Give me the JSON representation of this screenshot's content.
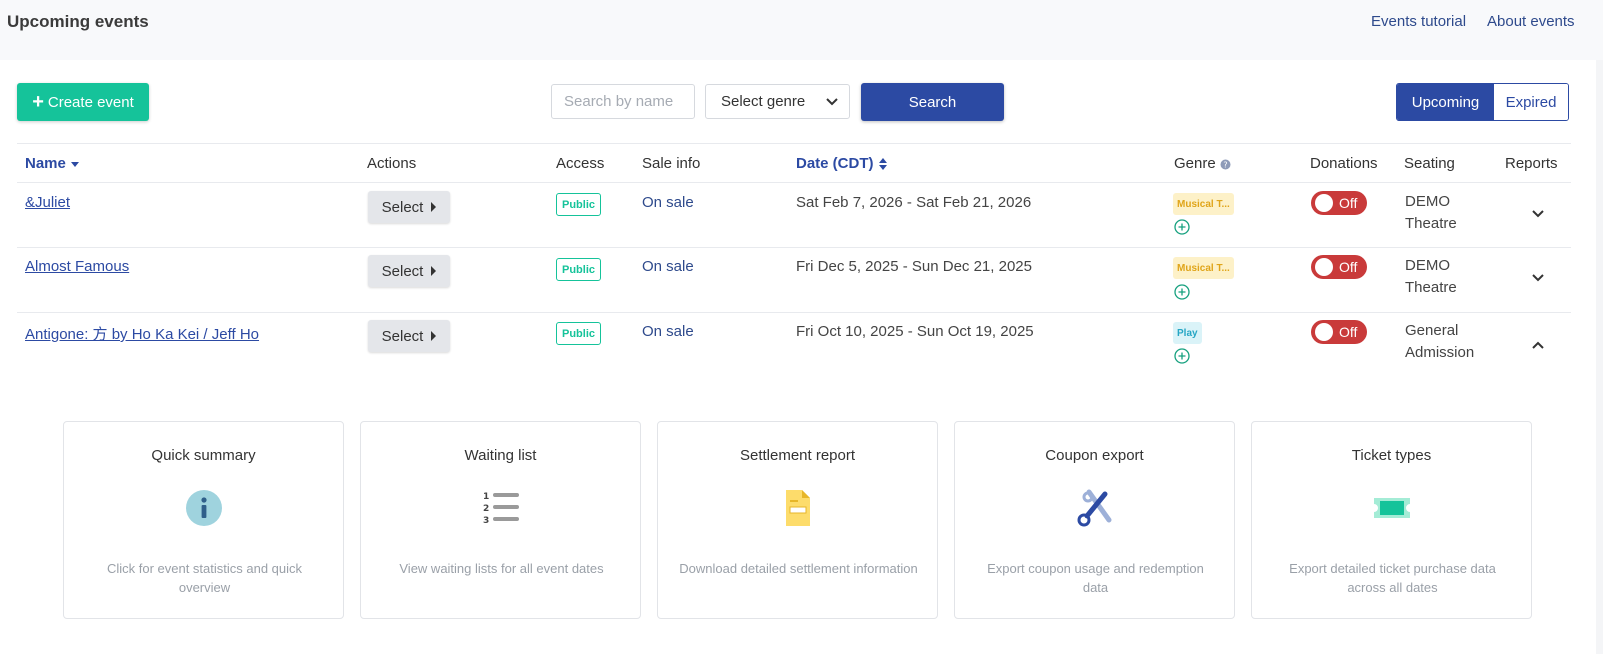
{
  "header": {
    "title": "Upcoming events",
    "links": [
      "Events tutorial",
      "About events"
    ]
  },
  "toolbar": {
    "create_label": "Create event",
    "search_placeholder": "Search by name",
    "genre_select": "Select genre",
    "search_label": "Search",
    "filter_upcoming": "Upcoming",
    "filter_expired": "Expired"
  },
  "table": {
    "columns": [
      "Name",
      "Actions",
      "Access",
      "Sale info",
      "Date (CDT)",
      "Genre",
      "Donations",
      "Seating",
      "Reports"
    ],
    "rows": [
      {
        "name": "&Juliet",
        "action": "Select",
        "access": "Public",
        "sale": "On sale",
        "date": "Sat Feb 7, 2026 - Sat Feb 21, 2026",
        "genre": "Musical T...",
        "donations": "Off",
        "seating": "DEMO Theatre"
      },
      {
        "name": "Almost Famous",
        "action": "Select",
        "access": "Public",
        "sale": "On sale",
        "date": "Fri Dec 5, 2025 - Sun Dec 21, 2025",
        "genre": "Musical T...",
        "donations": "Off",
        "seating": "DEMO Theatre"
      },
      {
        "name": "Antigone: 方 by Ho Ka Kei / Jeff Ho",
        "action": "Select",
        "access": "Public",
        "sale": "On sale",
        "date": "Fri Oct 10, 2025 - Sun Oct 19, 2025",
        "genre": "Play",
        "donations": "Off",
        "seating": "General Admission"
      }
    ]
  },
  "reports": [
    {
      "title": "Quick summary",
      "desc": "Click for event statistics and quick overview",
      "icon": "info-icon"
    },
    {
      "title": "Waiting list",
      "desc": "View waiting lists for all event dates",
      "icon": "numbered-list-icon"
    },
    {
      "title": "Settlement report",
      "desc": "Download detailed settlement information",
      "icon": "document-icon"
    },
    {
      "title": "Coupon export",
      "desc": "Export coupon usage and redemption data",
      "icon": "scissors-icon"
    },
    {
      "title": "Ticket types",
      "desc": "Export detailed ticket purchase data across all dates",
      "icon": "ticket-icon"
    }
  ],
  "colors": {
    "accent_green": "#15c39a",
    "primary_blue": "#2c4aa3",
    "off_red": "#c93a3a",
    "musical_tag": "#fdf1c8",
    "play_tag": "#daf3f8"
  }
}
